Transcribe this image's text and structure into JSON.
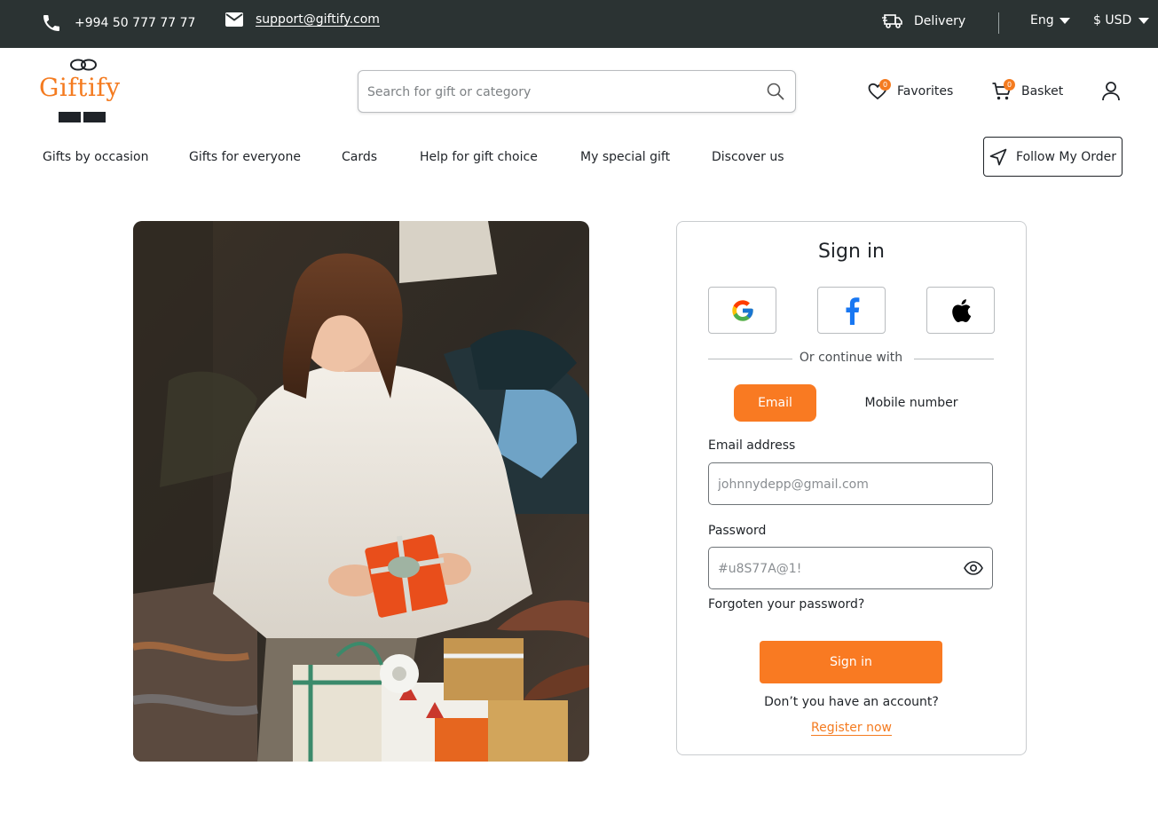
{
  "topbar": {
    "phone": "+994 50 777 77 77",
    "email": "support@giftify.com",
    "delivery": "Delivery",
    "language": "Eng",
    "currency": "$ USD"
  },
  "header": {
    "logo_text": "Giftify",
    "search_placeholder": "Search for gift or category",
    "favorites_label": "Favorites",
    "favorites_count": "0",
    "basket_label": "Basket",
    "basket_count": "0"
  },
  "nav": {
    "items": [
      "Gifts by occasion",
      "Gifts for everyone",
      "Cards",
      "Help for gift choice",
      "My special gift",
      "Discover us"
    ],
    "follow_order": "Follow My Order"
  },
  "signin": {
    "title": "Sign in",
    "divider_text": "Or continue with",
    "tab_email": "Email",
    "tab_mobile": "Mobile number",
    "email_label": "Email address",
    "email_placeholder": "johnnydepp@gmail.com",
    "password_label": "Password",
    "password_placeholder": "#u8S77A@1!",
    "forgot": "Forgoten your password?",
    "submit": "Sign in",
    "no_account": "Don’t you have an account?",
    "register": "Register now"
  },
  "colors": {
    "accent": "#f97a22",
    "topbar_bg": "#2b3333",
    "text": "#1f2328"
  },
  "icons": [
    "phone-icon",
    "mail-icon",
    "delivery-truck-icon",
    "chevron-down-icon",
    "search-icon",
    "heart-icon",
    "cart-icon",
    "user-icon",
    "navigation-arrow-icon",
    "google-icon",
    "facebook-icon",
    "apple-icon",
    "eye-icon"
  ]
}
